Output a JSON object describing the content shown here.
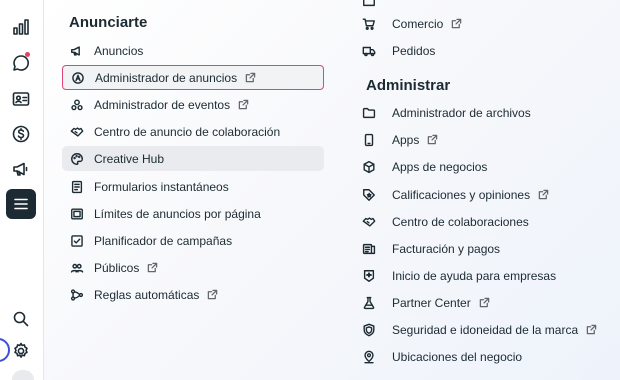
{
  "rail": {
    "icons": [
      "bar-chart-icon",
      "chat-bubble-icon",
      "contact-card-icon",
      "dollar-icon",
      "megaphone-icon",
      "menu-icon",
      "search-icon",
      "gear-icon"
    ]
  },
  "anunciarte": {
    "title": "Anunciarte",
    "items": [
      {
        "label": "Anuncios"
      },
      {
        "label": "Administrador de anuncios"
      },
      {
        "label": "Administrador de eventos"
      },
      {
        "label": "Centro de anuncio de colaboración"
      },
      {
        "label": "Creative Hub"
      },
      {
        "label": "Formularios instantáneos"
      },
      {
        "label": "Límites de anuncios por página"
      },
      {
        "label": "Planificador de campañas"
      },
      {
        "label": "Públicos"
      },
      {
        "label": "Reglas automáticas"
      }
    ]
  },
  "vender": {
    "items": [
      {
        "label": "Comercio"
      },
      {
        "label": "Pedidos"
      }
    ]
  },
  "administrar": {
    "title": "Administrar",
    "items": [
      {
        "label": "Administrador de archivos"
      },
      {
        "label": "Apps"
      },
      {
        "label": "Apps de negocios"
      },
      {
        "label": "Calificaciones y opiniones"
      },
      {
        "label": "Centro de colaboraciones"
      },
      {
        "label": "Facturación y pagos"
      },
      {
        "label": "Inicio de ayuda para empresas"
      },
      {
        "label": "Partner Center"
      },
      {
        "label": "Seguridad e idoneidad de la marca"
      },
      {
        "label": "Ubicaciones del negocio"
      }
    ]
  },
  "colors": {
    "accent_selected_border": "#e0447c",
    "active_rail_bg": "#1c2b33",
    "text": "#1c2b33",
    "notification_dot": "#e4405f",
    "focus_ring": "#3d4fd6"
  }
}
